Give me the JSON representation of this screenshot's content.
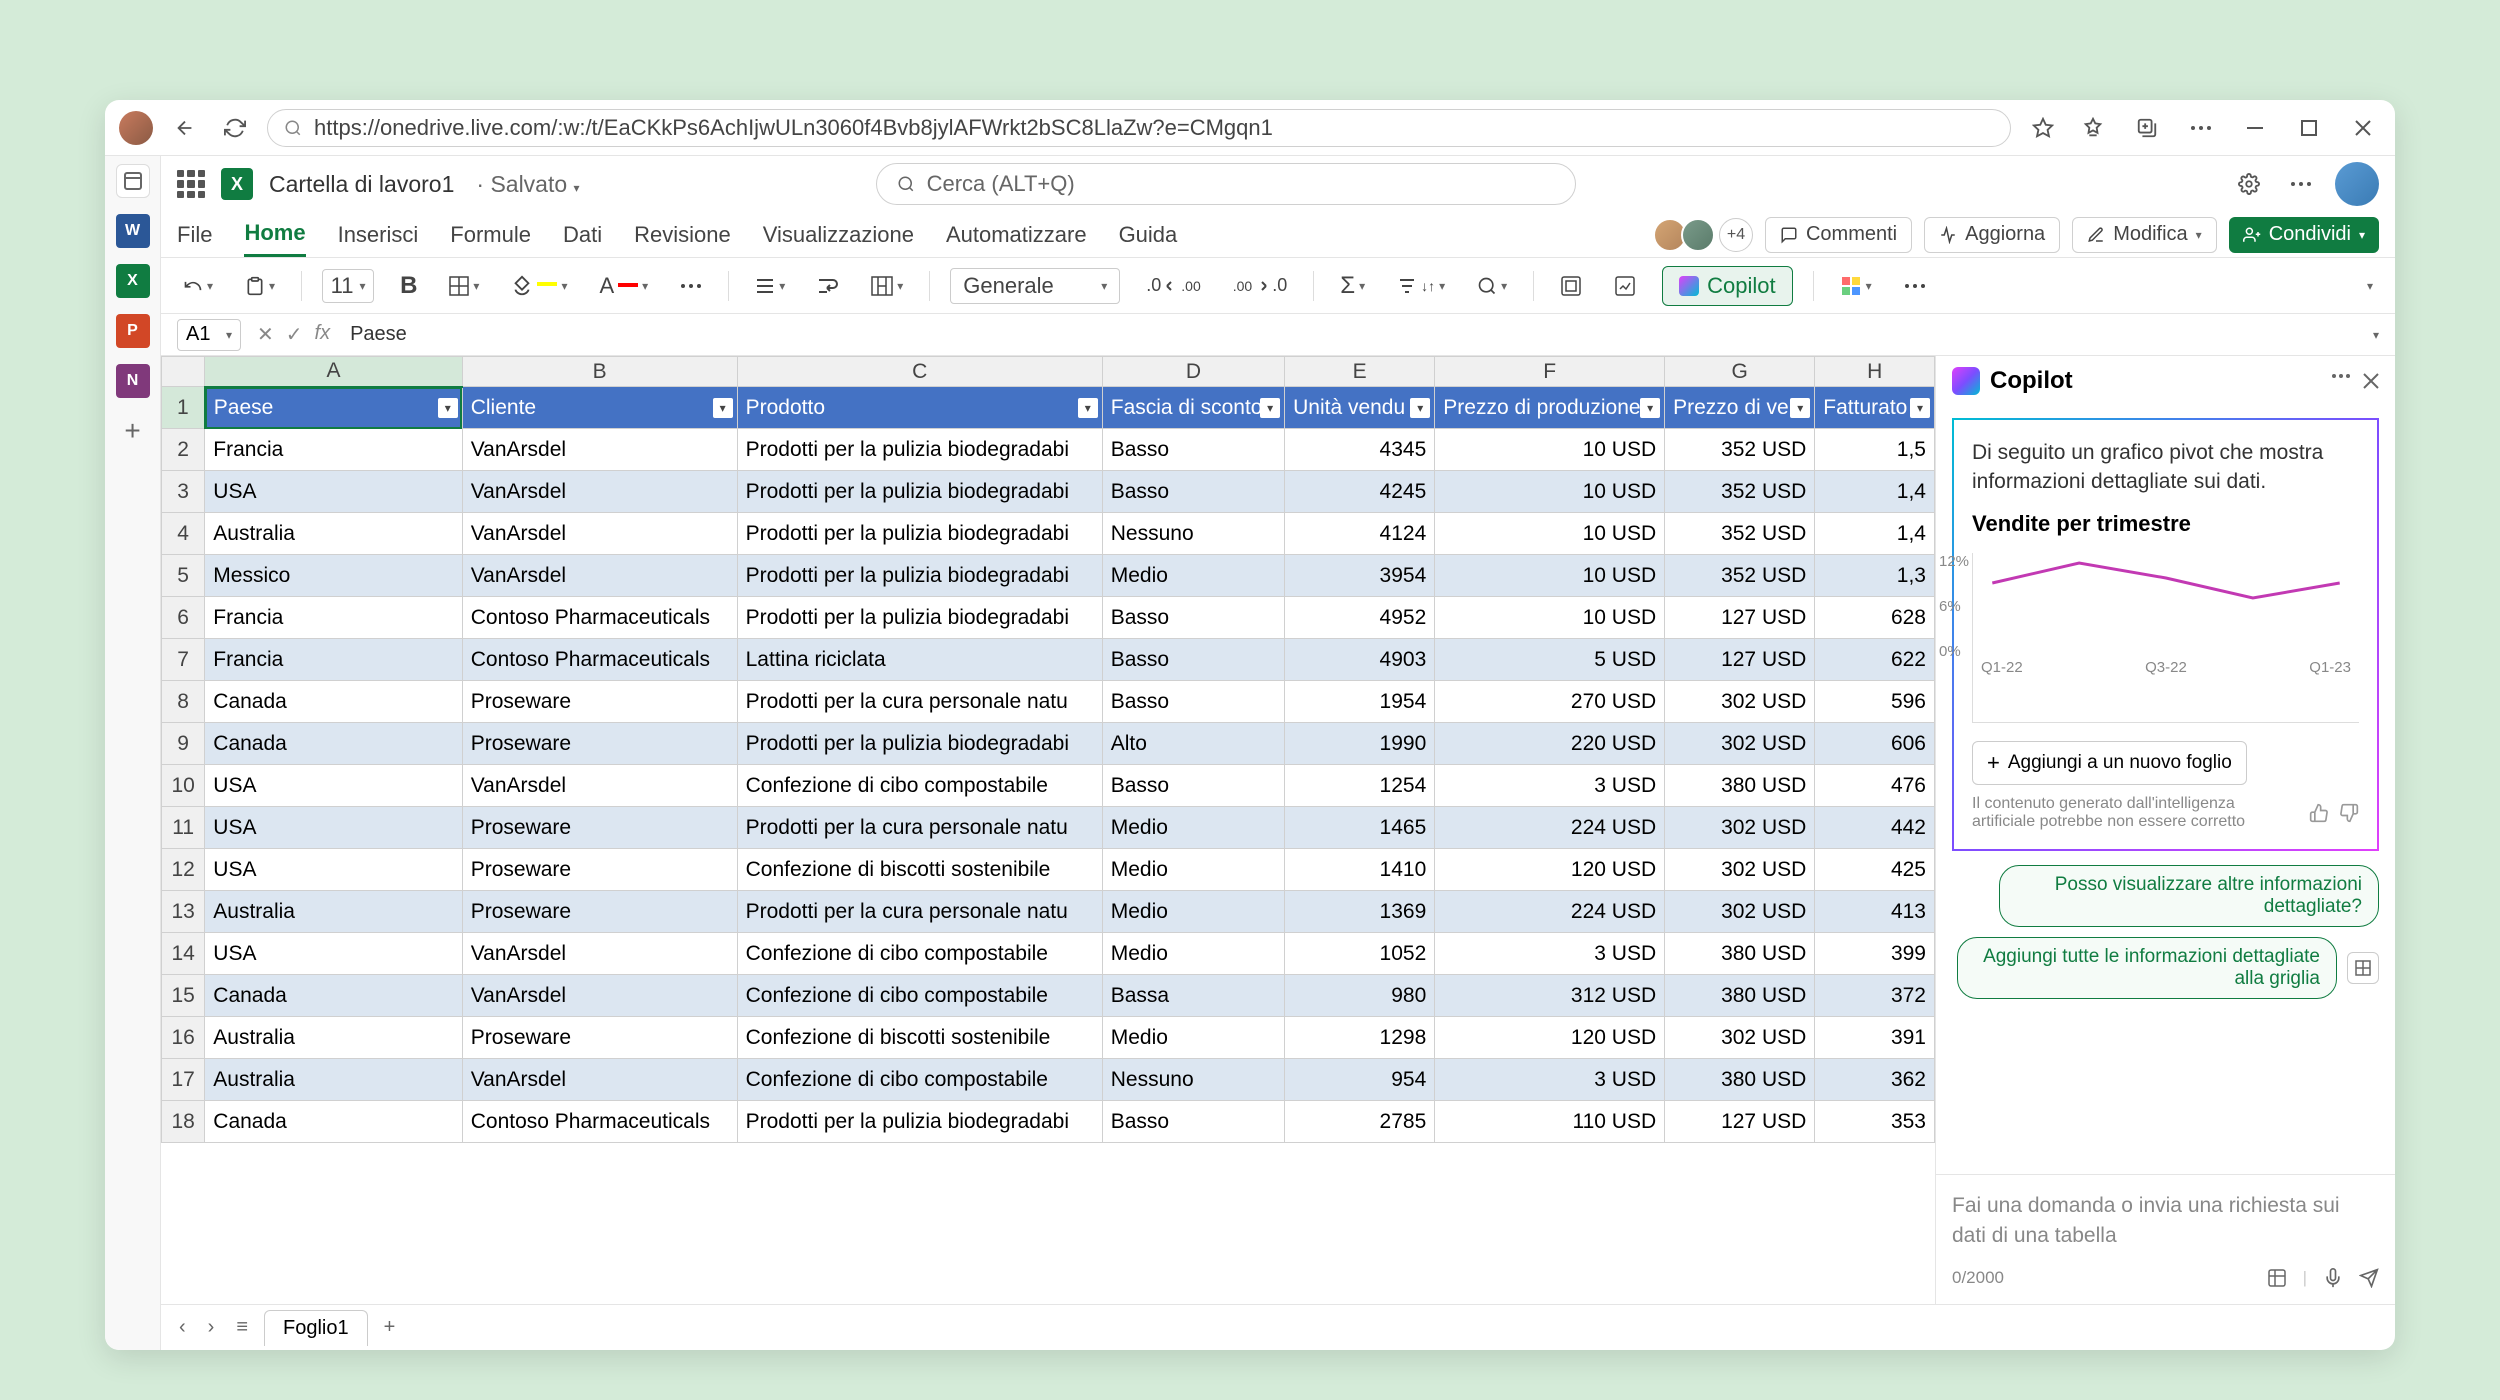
{
  "browser": {
    "url": "https://onedrive.live.com/:w:/t/EaCKkPs6AchIjwULn3060f4Bvb8jylAFWrkt2bSC8LlaZw?e=CMgqn1"
  },
  "titlebar": {
    "doc_name": "Cartella di lavoro1",
    "status": "Salvato",
    "search_placeholder": "Cerca (ALT+Q)"
  },
  "ribbon": {
    "tabs": [
      "File",
      "Home",
      "Inserisci",
      "Formule",
      "Dati",
      "Revisione",
      "Visualizzazione",
      "Automatizzare",
      "Guida"
    ],
    "active_tab": "Home",
    "presence_more": "+4",
    "comments": "Commenti",
    "catchup": "Aggiorna",
    "editing": "Modifica",
    "share": "Condividi"
  },
  "toolbar": {
    "font_size": "11",
    "number_format": "Generale",
    "copilot_label": "Copilot"
  },
  "formula": {
    "cell_ref": "A1",
    "value": "Paese"
  },
  "columns": [
    "A",
    "B",
    "C",
    "D",
    "E",
    "F",
    "G",
    "H"
  ],
  "headers": [
    "Paese",
    "Cliente",
    "Prodotto",
    "Fascia di sconto",
    "Unità vendu",
    "Prezzo di produzione",
    "Prezzo di ve",
    "Fatturato l"
  ],
  "rows": [
    {
      "n": 2,
      "c": [
        "Francia",
        "VanArsdel",
        "Prodotti per la pulizia biodegradabi",
        "Basso",
        "4345",
        "10 USD",
        "352 USD",
        "1,5"
      ]
    },
    {
      "n": 3,
      "c": [
        "USA",
        "VanArsdel",
        "Prodotti per la pulizia biodegradabi",
        "Basso",
        "4245",
        "10 USD",
        "352 USD",
        "1,4"
      ]
    },
    {
      "n": 4,
      "c": [
        "Australia",
        "VanArsdel",
        "Prodotti per la pulizia biodegradabi",
        "Nessuno",
        "4124",
        "10 USD",
        "352 USD",
        "1,4"
      ]
    },
    {
      "n": 5,
      "c": [
        "Messico",
        "VanArsdel",
        "Prodotti per la pulizia biodegradabi",
        "Medio",
        "3954",
        "10 USD",
        "352 USD",
        "1,3"
      ]
    },
    {
      "n": 6,
      "c": [
        "Francia",
        "Contoso Pharmaceuticals",
        "Prodotti per la pulizia biodegradabi",
        "Basso",
        "4952",
        "10 USD",
        "127 USD",
        "628"
      ]
    },
    {
      "n": 7,
      "c": [
        "Francia",
        "Contoso Pharmaceuticals",
        "Lattina riciclata",
        "Basso",
        "4903",
        "5 USD",
        "127 USD",
        "622"
      ]
    },
    {
      "n": 8,
      "c": [
        "Canada",
        "Proseware",
        "Prodotti per la cura personale natu",
        "Basso",
        "1954",
        "270 USD",
        "302 USD",
        "596"
      ]
    },
    {
      "n": 9,
      "c": [
        "Canada",
        "Proseware",
        "Prodotti per la pulizia biodegradabi",
        "Alto",
        "1990",
        "220 USD",
        "302 USD",
        "606"
      ]
    },
    {
      "n": 10,
      "c": [
        "USA",
        "VanArsdel",
        "Confezione di cibo compostabile",
        "Basso",
        "1254",
        "3 USD",
        "380 USD",
        "476"
      ]
    },
    {
      "n": 11,
      "c": [
        "USA",
        "Proseware",
        "Prodotti per la cura personale natu",
        "Medio",
        "1465",
        "224 USD",
        "302 USD",
        "442"
      ]
    },
    {
      "n": 12,
      "c": [
        "USA",
        "Proseware",
        "Confezione di biscotti sostenibile",
        "Medio",
        "1410",
        "120 USD",
        "302 USD",
        "425"
      ]
    },
    {
      "n": 13,
      "c": [
        "Australia",
        "Proseware",
        "Prodotti per la cura personale natu",
        "Medio",
        "1369",
        "224 USD",
        "302 USD",
        "413"
      ]
    },
    {
      "n": 14,
      "c": [
        "USA",
        "VanArsdel",
        "Confezione di cibo compostabile",
        "Medio",
        "1052",
        "3 USD",
        "380 USD",
        "399"
      ]
    },
    {
      "n": 15,
      "c": [
        "Canada",
        "VanArsdel",
        "Confezione di cibo compostabile",
        "Bassa",
        "980",
        "312 USD",
        "380 USD",
        "372"
      ]
    },
    {
      "n": 16,
      "c": [
        "Australia",
        "Proseware",
        "Confezione di biscotti sostenibile",
        "Medio",
        "1298",
        "120 USD",
        "302 USD",
        "391"
      ]
    },
    {
      "n": 17,
      "c": [
        "Australia",
        "VanArsdel",
        "Confezione di cibo compostabile",
        "Nessuno",
        "954",
        "3 USD",
        "380 USD",
        "362"
      ]
    },
    {
      "n": 18,
      "c": [
        "Canada",
        "Contoso Pharmaceuticals",
        "Prodotti per la pulizia biodegradabi",
        "Basso",
        "2785",
        "110 USD",
        "127 USD",
        "353"
      ]
    }
  ],
  "copilot": {
    "title": "Copilot",
    "response_intro": "Di seguito un grafico pivot che mostra informazioni dettagliate sui dati.",
    "chart_title": "Vendite per trimestre",
    "add_sheet": "Aggiungi a un nuovo foglio",
    "disclaimer": "Il contenuto generato dall'intelligenza artificiale potrebbe non essere corretto",
    "sugg1": "Posso visualizzare altre informazioni dettagliate?",
    "sugg2": "Aggiungi tutte le informazioni dettagliate alla griglia",
    "input_placeholder": "Fai una domanda o invia una richiesta sui dati di una tabella",
    "char_count": "0/2000"
  },
  "chart_data": {
    "type": "line",
    "title": "Vendite per trimestre",
    "categories": [
      "Q1-22",
      "Q3-22",
      "Q1-23"
    ],
    "values": [
      9,
      12,
      10,
      8,
      10
    ],
    "ylabel_ticks": [
      "12%",
      "6%",
      "0%"
    ],
    "ylim": [
      0,
      12
    ]
  },
  "sheets": {
    "active": "Foglio1"
  }
}
